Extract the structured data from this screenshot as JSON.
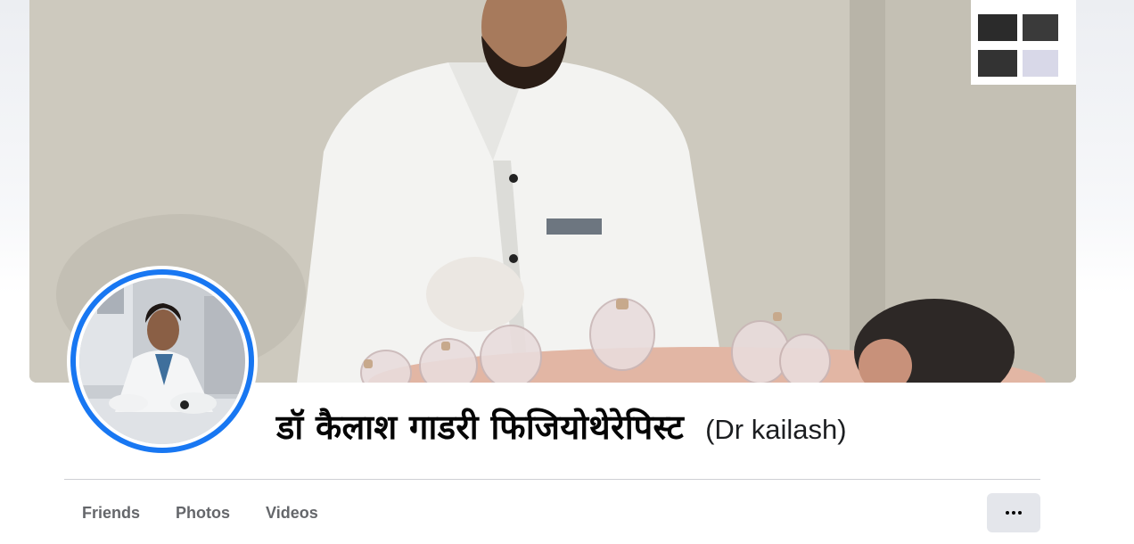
{
  "profile": {
    "name": "डॉ कैलाश गाडरी फिजियोथेरेपिस्ट",
    "alternate_name": "(Dr kailash)"
  },
  "tabs": [
    {
      "label": "Friends"
    },
    {
      "label": "Photos"
    },
    {
      "label": "Videos"
    }
  ],
  "colors": {
    "accent": "#1877f2",
    "tab_text": "#65676b",
    "more_button_bg": "#e4e6eb"
  },
  "icons": {
    "more": "ellipsis-icon"
  }
}
